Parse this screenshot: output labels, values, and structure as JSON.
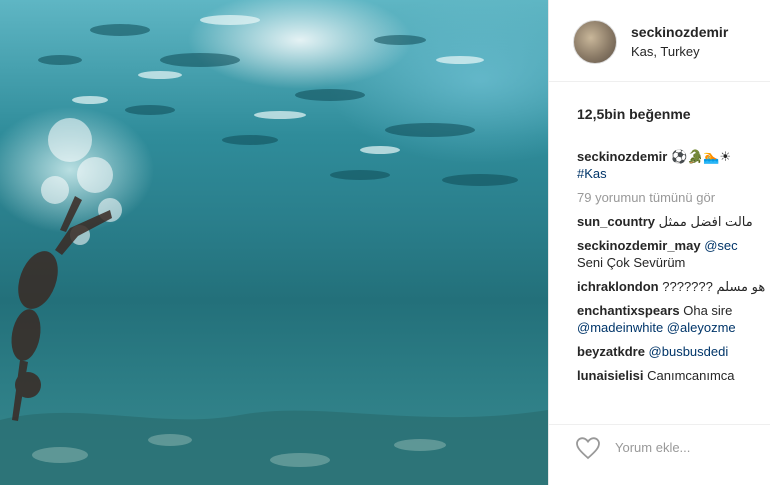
{
  "post": {
    "username": "seckinozdemir",
    "location": "Kas, Turkey",
    "likes": "12,5bin beğenme"
  },
  "caption": {
    "user": "seckinozdemir",
    "text": "⚽🐊🏊☀",
    "hashtag": "#Kas"
  },
  "view_all": "79 yorumun tümünü gör",
  "comments": [
    {
      "user": "sun_country",
      "text": "مالت افضل ممثل"
    },
    {
      "user": "seckinozdemir_may",
      "text": "@sec"
    },
    {
      "user": "",
      "text": "Seni Çok Sevürüm"
    },
    {
      "user": "ichraklondon",
      "text": "??????? هو مسلم"
    },
    {
      "user": "enchantixspears",
      "text": "Oha sire"
    },
    {
      "user": "",
      "text": "@madeinwhite @aleyozme"
    },
    {
      "user": "beyzatkdre",
      "text": "@busbusdedi"
    },
    {
      "user": "lunaisielisi",
      "text": "Canımcanımca"
    }
  ],
  "add_comment_placeholder": "Yorum ekle...",
  "icons": {
    "like": "heart-outline-icon"
  },
  "colors": {
    "text": "#262626",
    "muted": "#999999",
    "link": "#003569"
  }
}
